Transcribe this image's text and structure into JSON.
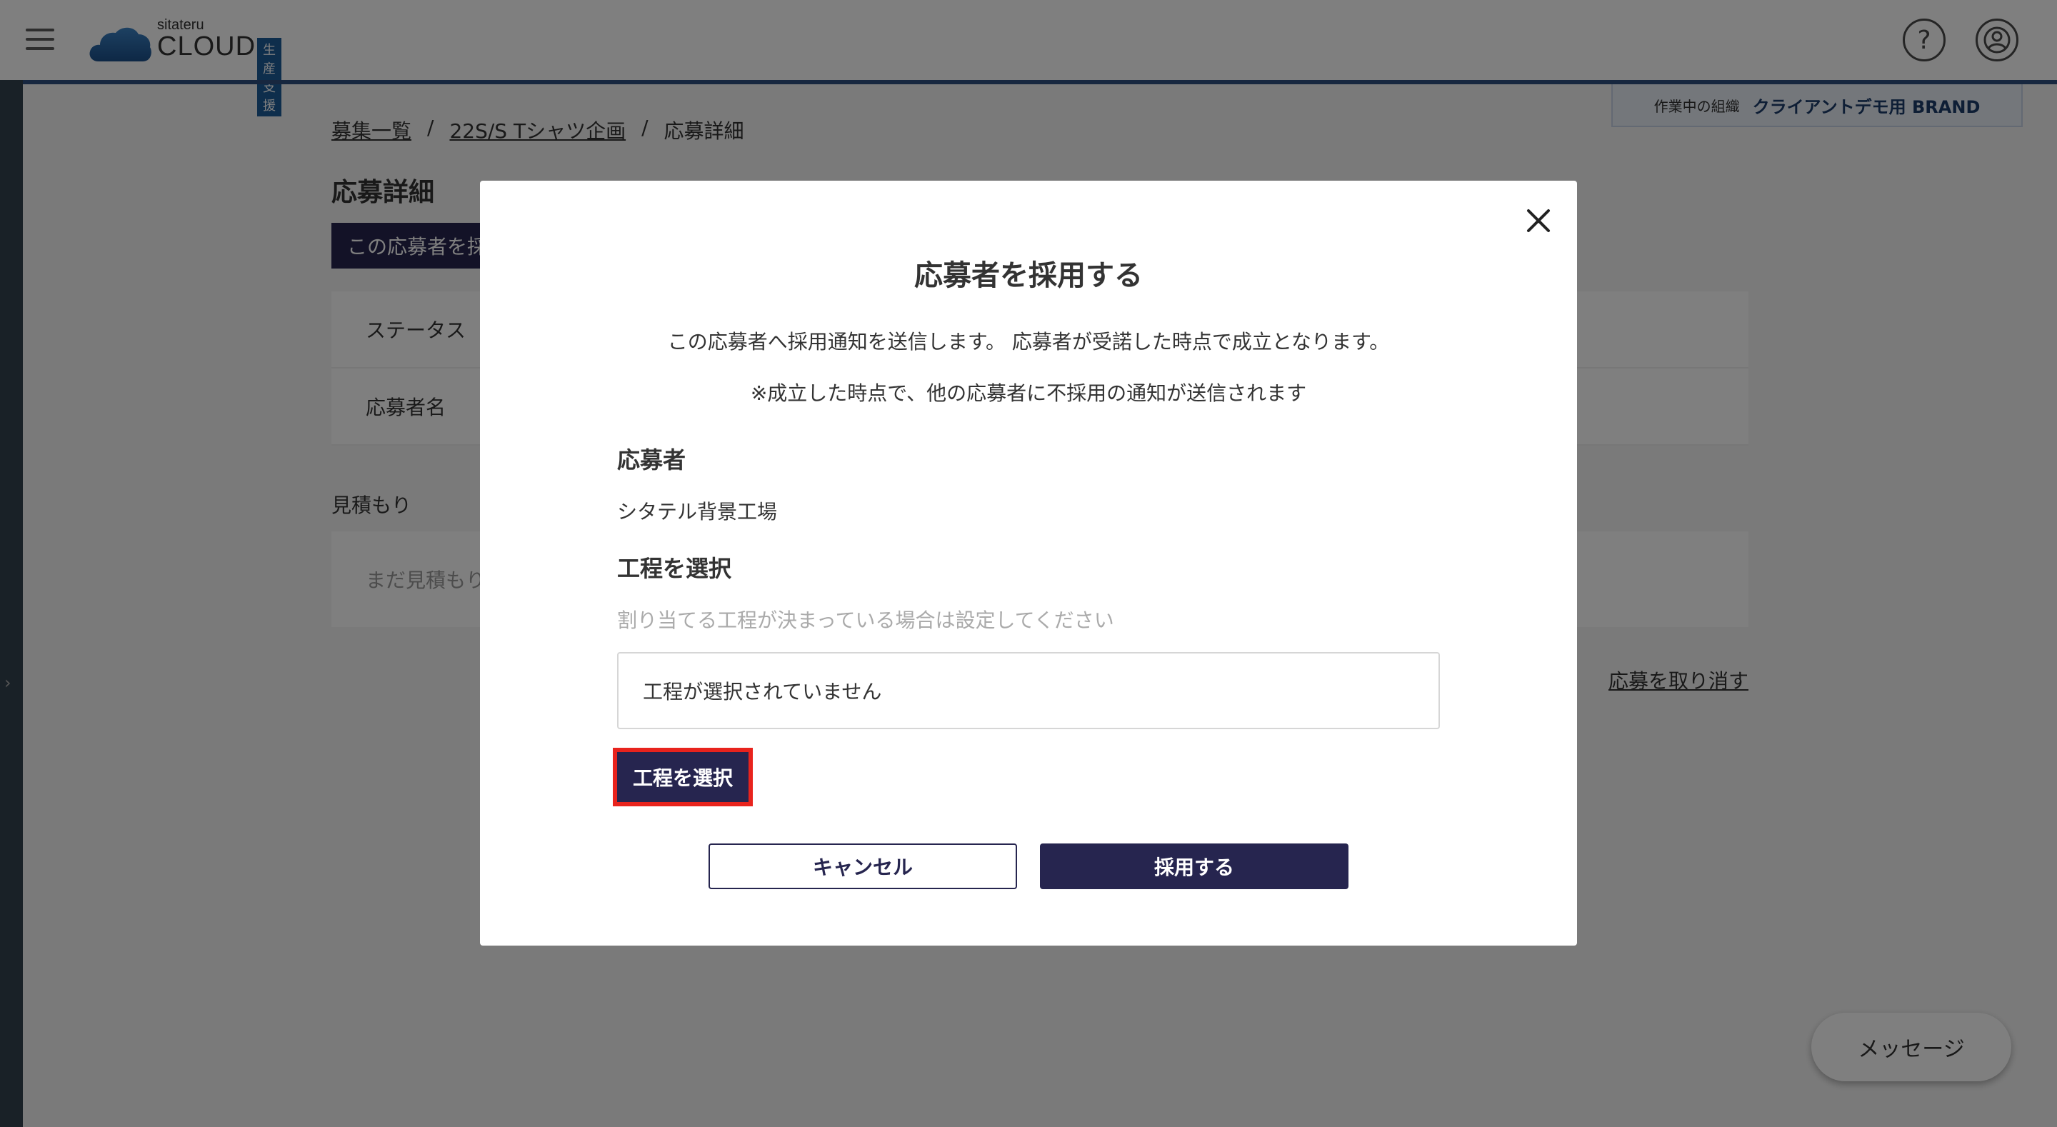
{
  "header": {
    "logo_small": "sitateru",
    "logo_main": "CLOUD",
    "logo_badge": "生産支援",
    "help_symbol": "?",
    "icons": {
      "menu": "hamburger-icon",
      "help": "question-icon",
      "user": "user-circle-icon",
      "close": "close-icon"
    }
  },
  "org": {
    "label": "作業中の組織",
    "name": "クライアントデモ用 BRAND"
  },
  "breadcrumb": {
    "items": [
      "募集一覧",
      "22S/S Tシャツ企画",
      "応募詳細"
    ],
    "separator": "/"
  },
  "page": {
    "title": "応募詳細",
    "adopt_button": "この応募者を採",
    "status_label": "ステータス",
    "applicant_label": "応募者名",
    "estimate_label": "見積もり",
    "estimate_empty": "まだ見積もり",
    "cancel_application": "応募を取り消す",
    "message_button": "メッセージ"
  },
  "modal": {
    "title": "応募者を採用する",
    "desc1": "この応募者へ採用通知を送信します。 応募者が受諾した時点で成立となります。",
    "desc2": "※成立した時点で、他の応募者に不採用の通知が送信されます",
    "applicant_heading": "応募者",
    "applicant_name": "シタテル背景工場",
    "process_heading": "工程を選択",
    "process_hint": "割り当てる工程が決まっている場合は設定してください",
    "process_value": "工程が選択されていません",
    "select_process_button": "工程を選択",
    "cancel_button": "キャンセル",
    "adopt_button": "採用する"
  },
  "colors": {
    "primary": "#26254f",
    "highlight": "#e8231d",
    "header_line": "#2f4f7f",
    "logo_blue": "#1d5c99"
  }
}
